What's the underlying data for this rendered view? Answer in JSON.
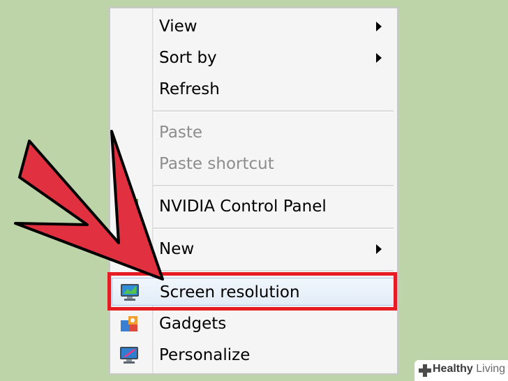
{
  "menu": {
    "items": [
      {
        "label": "View",
        "has_submenu": true,
        "enabled": true
      },
      {
        "label": "Sort by",
        "has_submenu": true,
        "enabled": true
      },
      {
        "label": "Refresh",
        "has_submenu": false,
        "enabled": true
      },
      {
        "label": "Paste",
        "has_submenu": false,
        "enabled": false
      },
      {
        "label": "Paste shortcut",
        "has_submenu": false,
        "enabled": false
      },
      {
        "label": "NVIDIA Control Panel",
        "has_submenu": false,
        "enabled": true,
        "icon": "nvidia-icon"
      },
      {
        "label": "New",
        "has_submenu": true,
        "enabled": true
      },
      {
        "label": "Screen resolution",
        "has_submenu": false,
        "enabled": true,
        "icon": "monitor-icon",
        "highlighted": true
      },
      {
        "label": "Gadgets",
        "has_submenu": false,
        "enabled": true,
        "icon": "gadgets-icon"
      },
      {
        "label": "Personalize",
        "has_submenu": false,
        "enabled": true,
        "icon": "personalize-icon"
      }
    ]
  },
  "annotation": {
    "highlight_color": "#e51c23",
    "arrow_color": "#e1303f"
  },
  "watermark": {
    "brand_bold": "Healthy",
    "brand_rest": " Living"
  }
}
